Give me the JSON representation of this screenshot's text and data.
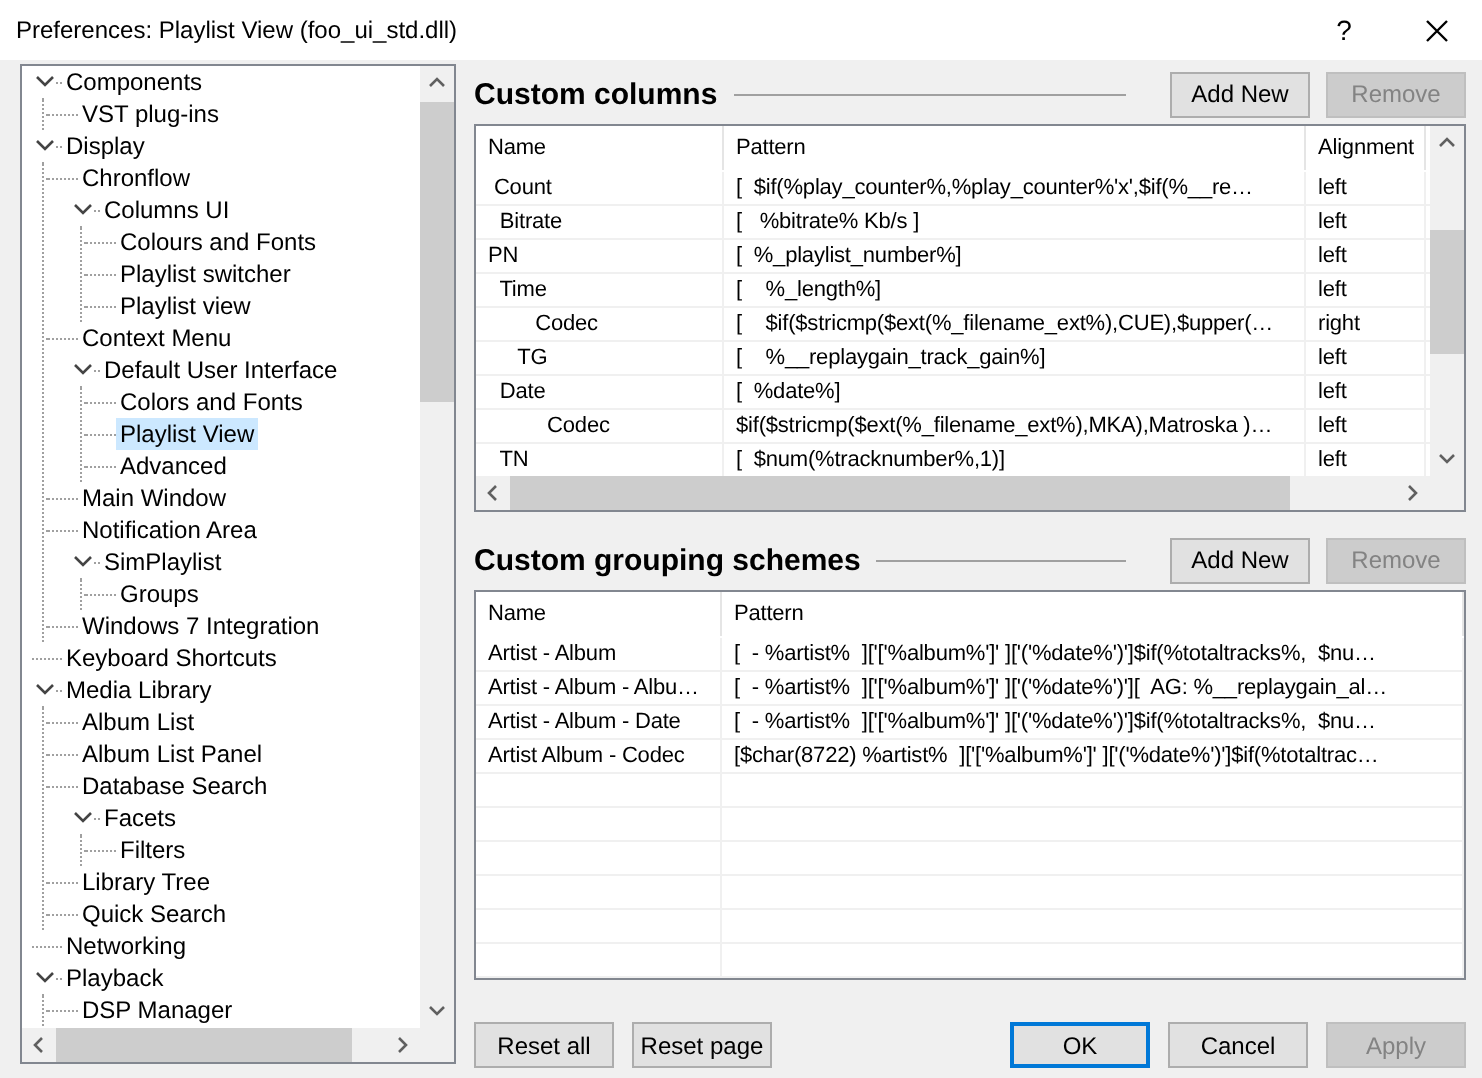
{
  "window": {
    "title": "Preferences: Playlist View (foo_ui_std.dll)",
    "help": "?"
  },
  "tree": [
    {
      "label": "Components",
      "expanded": true,
      "selected": false,
      "children": [
        {
          "label": "VST plug-ins",
          "selected": false
        }
      ]
    },
    {
      "label": "Display",
      "expanded": true,
      "selected": false,
      "children": [
        {
          "label": "Chronflow",
          "selected": false
        },
        {
          "label": "Columns UI",
          "expanded": true,
          "selected": false,
          "children": [
            {
              "label": "Colours and Fonts",
              "selected": false
            },
            {
              "label": "Playlist switcher",
              "selected": false
            },
            {
              "label": "Playlist view",
              "selected": false
            }
          ]
        },
        {
          "label": "Context Menu",
          "selected": false
        },
        {
          "label": "Default User Interface",
          "expanded": true,
          "selected": false,
          "children": [
            {
              "label": "Colors and Fonts",
              "selected": false
            },
            {
              "label": "Playlist View",
              "selected": true
            },
            {
              "label": "Advanced",
              "selected": false
            }
          ]
        },
        {
          "label": "Main Window",
          "selected": false
        },
        {
          "label": "Notification Area",
          "selected": false
        },
        {
          "label": "SimPlaylist",
          "expanded": true,
          "selected": false,
          "children": [
            {
              "label": "Groups",
              "selected": false
            }
          ]
        },
        {
          "label": "Windows 7 Integration",
          "selected": false
        }
      ]
    },
    {
      "label": "Keyboard Shortcuts",
      "selected": false
    },
    {
      "label": "Media Library",
      "expanded": true,
      "selected": false,
      "children": [
        {
          "label": "Album List",
          "selected": false
        },
        {
          "label": "Album List Panel",
          "selected": false
        },
        {
          "label": "Database Search",
          "selected": false
        },
        {
          "label": "Facets",
          "expanded": true,
          "selected": false,
          "children": [
            {
              "label": "Filters",
              "selected": false
            }
          ]
        },
        {
          "label": "Library Tree",
          "selected": false
        },
        {
          "label": "Quick Search",
          "selected": false
        }
      ]
    },
    {
      "label": "Networking",
      "selected": false
    },
    {
      "label": "Playback",
      "expanded": true,
      "selected": false,
      "children": [
        {
          "label": "DSP Manager",
          "selected": false
        }
      ]
    }
  ],
  "custom_columns": {
    "title": "Custom columns",
    "buttons": [
      {
        "label": "Add New",
        "disabled": false
      },
      {
        "label": "Remove",
        "disabled": true
      }
    ],
    "columns": [
      "Name",
      "Pattern",
      "Alignment"
    ],
    "rows": [
      {
        "name": " Count",
        "pattern": "[  $if(%play_counter%,%play_counter%'x',$if(%__re…",
        "alignment": "left"
      },
      {
        "name": "  Bitrate",
        "pattern": "[   %bitrate% Kb/s ]",
        "alignment": "left"
      },
      {
        "name": "PN",
        "pattern": "[  %_playlist_number%]",
        "alignment": "left"
      },
      {
        "name": "  Time",
        "pattern": "[    %_length%]",
        "alignment": "left"
      },
      {
        "name": "        Codec",
        "pattern": "[    $if($stricmp($ext(%_filename_ext%),CUE),$upper(…",
        "alignment": "right"
      },
      {
        "name": "     TG",
        "pattern": "[    %__replaygain_track_gain%]",
        "alignment": "left"
      },
      {
        "name": "  Date",
        "pattern": "[  %date%]",
        "alignment": "left"
      },
      {
        "name": "          Codec",
        "pattern": "$if($stricmp($ext(%_filename_ext%),MKA),Matroska )…",
        "alignment": "left"
      },
      {
        "name": "  TN",
        "pattern": "[  $num(%tracknumber%,1)]",
        "alignment": "left"
      }
    ]
  },
  "custom_grouping": {
    "title": "Custom grouping schemes",
    "buttons": [
      {
        "label": "Add New",
        "disabled": false
      },
      {
        "label": "Remove",
        "disabled": true
      }
    ],
    "columns": [
      "Name",
      "Pattern"
    ],
    "rows": [
      {
        "name": "Artist - Album",
        "pattern": "[  - %artist%  ]['['%album%']' ]['('%date%')']$if(%totaltracks%,  $nu…"
      },
      {
        "name": "Artist - Album - Albu…",
        "pattern": "[  - %artist%  ]['['%album%']' ]['('%date%')'][  AG: %__replaygain_al…"
      },
      {
        "name": "Artist - Album - Date",
        "pattern": "[  - %artist%  ]['['%album%']' ]['('%date%')']$if(%totaltracks%,  $nu…"
      },
      {
        "name": "Artist Album - Codec",
        "pattern": "[$char(8722) %artist%  ]['['%album%']' ]['('%date%')']$if(%totaltrac…"
      }
    ]
  },
  "footer": {
    "left_buttons": [
      {
        "label": "Reset all",
        "disabled": false
      },
      {
        "label": "Reset page",
        "disabled": false
      }
    ],
    "right_buttons": [
      {
        "label": "OK",
        "disabled": false,
        "default": true
      },
      {
        "label": "Cancel",
        "disabled": false,
        "default": false
      },
      {
        "label": "Apply",
        "disabled": true,
        "default": false
      }
    ]
  }
}
